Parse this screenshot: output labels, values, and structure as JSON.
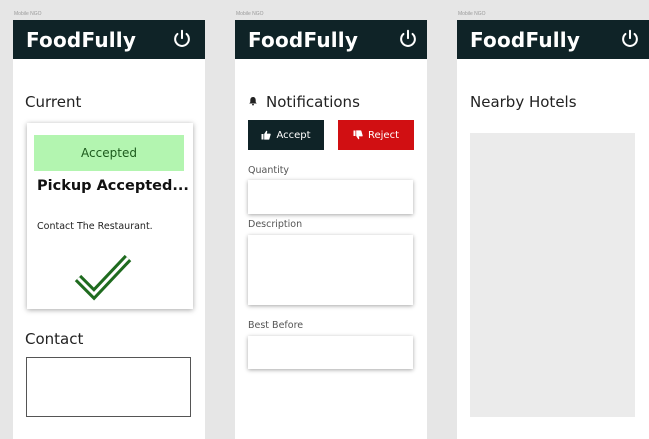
{
  "frames": [
    {
      "label": "Mobile NGO"
    },
    {
      "label": "Mobile NGO"
    },
    {
      "label": "Mobile NGO"
    }
  ],
  "app": {
    "brand": "FoodFully",
    "power_icon": "power-icon"
  },
  "screen1": {
    "current_title": "Current",
    "card": {
      "badge": "Accepted",
      "title": "Pickup Accepted...",
      "text": "Contact The Restaurant.",
      "check_icon": "checkmark-icon"
    },
    "contact_title": "Contact",
    "contact_value": ""
  },
  "screen2": {
    "notifications_title": "Notifications",
    "bell_icon": "bell-icon",
    "accept_label": "Accept",
    "reject_label": "Reject",
    "fields": {
      "quantity_label": "Quantity",
      "description_label": "Description",
      "best_before_label": "Best Before"
    }
  },
  "screen3": {
    "nearby_title": "Nearby Hotels"
  },
  "colors": {
    "appbar": "#0f2327",
    "accepted_bg": "#b3f5b0",
    "check_green": "#1f6b1f",
    "reject_red": "#d10f12",
    "canvas_bg": "#e6e6e6"
  }
}
